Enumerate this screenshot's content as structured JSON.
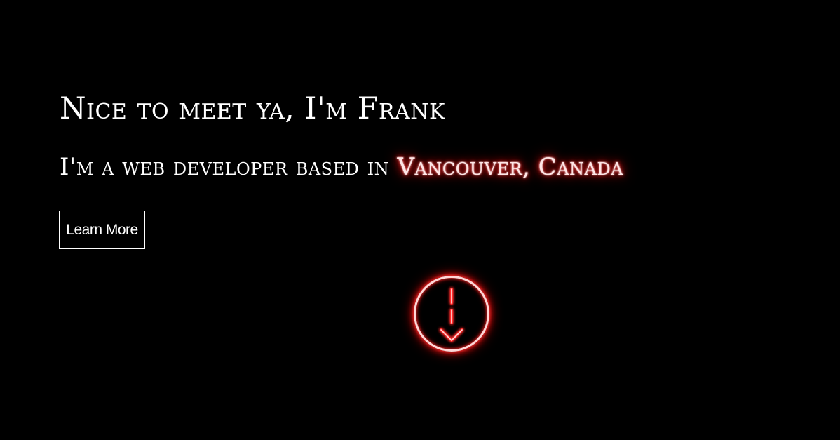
{
  "hero": {
    "headline": "Nice to meet ya, I'm Frank",
    "subline_prefix": "I'm a web developer based in ",
    "location": "Vancouver, Canada",
    "cta_label": "Learn More",
    "scroll_icon": "arrow-down-icon"
  },
  "colors": {
    "background": "#000000",
    "text": "#ffffff",
    "glow_accent": "#ff1a1a"
  }
}
